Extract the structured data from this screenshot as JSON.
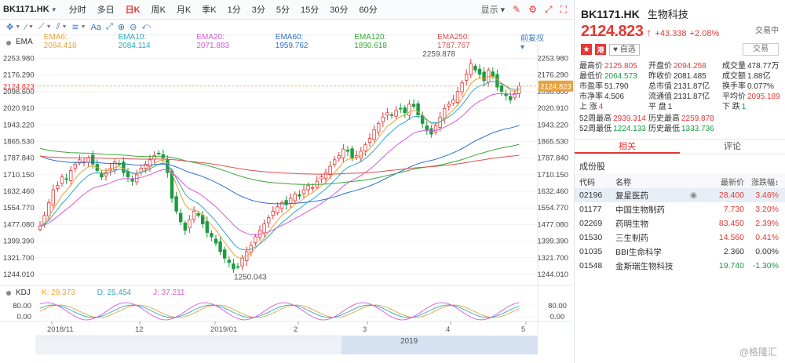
{
  "toolbar": {
    "symbol": "BK1171.HK",
    "periods": [
      "分时",
      "多日",
      "日K",
      "周K",
      "月K",
      "季K",
      "1分",
      "3分",
      "5分",
      "15分",
      "30分",
      "60分"
    ],
    "active_period": "日K",
    "display_label": "显示",
    "draw_tools": [
      "✥",
      "∕",
      "⟋",
      "⫽",
      "≋",
      "Aa",
      "⤢",
      "⊕",
      "⊖",
      "⤺"
    ]
  },
  "ema": {
    "label": "EMA",
    "items": [
      {
        "name": "EMA6",
        "value": "2084.418",
        "color": "#e8a33d"
      },
      {
        "name": "EMA10",
        "value": "2084.114",
        "color": "#2fa8c6"
      },
      {
        "name": "EMA20",
        "value": "2071.883",
        "color": "#d65ad6"
      },
      {
        "name": "EMA60",
        "value": "1959.762",
        "color": "#2b6fd1"
      },
      {
        "name": "EMA120",
        "value": "1890.618",
        "color": "#38a838"
      },
      {
        "name": "EMA250",
        "value": "1787.767",
        "color": "#e05050"
      }
    ],
    "fuquan": "前复权"
  },
  "kdj": {
    "label": "KDJ",
    "items": [
      {
        "name": "K",
        "value": "29.373",
        "color": "#e8a33d"
      },
      {
        "name": "D",
        "value": "25.454",
        "color": "#2fa8c6"
      },
      {
        "name": "J",
        "value": "37.211",
        "color": "#d65ad6"
      }
    ],
    "axis": [
      "80.00",
      "0.00"
    ]
  },
  "price_axis": [
    "2253.980",
    "2176.290",
    "2098.600",
    "2020.910",
    "1943.220",
    "1865.530",
    "1787.840",
    "1710.150",
    "1632.460",
    "1554.770",
    "1477.080",
    "1399.390",
    "1321.700",
    "1244.010"
  ],
  "current_price_tag": "2124.823",
  "high_mark": "2259.878",
  "low_mark": "1250.043",
  "date_axis": [
    "2018/11",
    "12",
    "2019/01",
    "2",
    "3",
    "4",
    "5"
  ],
  "scroll_year": "2019",
  "chart_data": {
    "type": "candlestick",
    "ylim": [
      1200,
      2300
    ],
    "high": 2259.878,
    "low": 1250.043,
    "last": 2124.823,
    "closes": [
      1470,
      1520,
      1580,
      1640,
      1660,
      1700,
      1690,
      1730,
      1760,
      1780,
      1770,
      1790,
      1760,
      1730,
      1700,
      1720,
      1740,
      1770,
      1760,
      1720,
      1700,
      1680,
      1710,
      1740,
      1760,
      1780,
      1800,
      1810,
      1790,
      1720,
      1600,
      1540,
      1490,
      1450,
      1500,
      1540,
      1520,
      1480,
      1440,
      1420,
      1390,
      1350,
      1320,
      1300,
      1270,
      1280,
      1320,
      1350,
      1380,
      1420,
      1450,
      1480,
      1510,
      1540,
      1560,
      1580,
      1570,
      1600,
      1620,
      1610,
      1640,
      1660,
      1650,
      1680,
      1700,
      1720,
      1750,
      1780,
      1800,
      1830,
      1820,
      1790,
      1800,
      1820,
      1850,
      1880,
      1920,
      1950,
      1980,
      2000,
      1990,
      2010,
      2020,
      2000,
      2040,
      2030,
      1990,
      1950,
      1920,
      1900,
      1940,
      1980,
      2020,
      2040,
      2060,
      2100,
      2140,
      2180,
      2230,
      2200,
      2180,
      2150,
      2200,
      2170,
      2120,
      2100,
      2080,
      2060,
      2090,
      2124.823
    ]
  },
  "panel": {
    "code": "BK1171.HK",
    "name": "生物科技",
    "status": "交易中",
    "price": "2124.823",
    "arrow": "↑",
    "change": "+43.338",
    "change_pct": "+2.08%",
    "hk_tag": "港",
    "fav_label": "自选",
    "trade_label": "交易",
    "quotes": [
      {
        "k": "最高价",
        "v": "2125.805",
        "cls": "red"
      },
      {
        "k": "开盘价",
        "v": "2094.258",
        "cls": "red"
      },
      {
        "k": "成交量",
        "v": "478.77万",
        "cls": ""
      },
      {
        "k": "最低价",
        "v": "2064.573",
        "cls": "green"
      },
      {
        "k": "昨收价",
        "v": "2081.485",
        "cls": ""
      },
      {
        "k": "成交额",
        "v": "1.88亿",
        "cls": ""
      },
      {
        "k": "市盈率",
        "v": "51.790",
        "cls": ""
      },
      {
        "k": "总市值",
        "v": "2131.87亿",
        "cls": ""
      },
      {
        "k": "换手率",
        "v": "0.077%",
        "cls": ""
      },
      {
        "k": "市净率",
        "v": "4.506",
        "cls": ""
      },
      {
        "k": "流通值",
        "v": "2131.87亿",
        "cls": ""
      },
      {
        "k": "平均价",
        "v": "2095.189",
        "cls": "red"
      },
      {
        "k": "上 涨",
        "v": "4",
        "cls": "red"
      },
      {
        "k": "平 盘",
        "v": "1",
        "cls": ""
      },
      {
        "k": "下 跌",
        "v": "1",
        "cls": "green"
      }
    ],
    "quotes2": [
      {
        "k": "52周最高",
        "v": "2939.314",
        "cls": "red"
      },
      {
        "k": "历史最高",
        "v": "2259.878",
        "cls": "red"
      },
      {
        "k": "52周最低",
        "v": "1224.133",
        "cls": "green"
      },
      {
        "k": "历史最低",
        "v": "1333.736",
        "cls": "green"
      }
    ],
    "tabs": [
      "相关",
      "评论"
    ],
    "section": "成份股",
    "headers": [
      "代码",
      "名称",
      "最新价",
      "涨跌幅"
    ],
    "rows": [
      {
        "code": "02196",
        "name": "复星医药",
        "price": "28.400",
        "pct": "3.46%",
        "cls": "red"
      },
      {
        "code": "01177",
        "name": "中国生物制药",
        "price": "7.730",
        "pct": "3.20%",
        "cls": "red"
      },
      {
        "code": "02269",
        "name": "药明生物",
        "price": "83.450",
        "pct": "2.39%",
        "cls": "red"
      },
      {
        "code": "01530",
        "name": "三生制药",
        "price": "14.560",
        "pct": "0.41%",
        "cls": "red"
      },
      {
        "code": "01035",
        "name": "BBI生命科学",
        "price": "2.360",
        "pct": "0.00%",
        "cls": ""
      },
      {
        "code": "01548",
        "name": "金斯瑞生物科技",
        "price": "19.740",
        "pct": "-1.30%",
        "cls": "green"
      }
    ],
    "watermark": "@格隆汇"
  }
}
